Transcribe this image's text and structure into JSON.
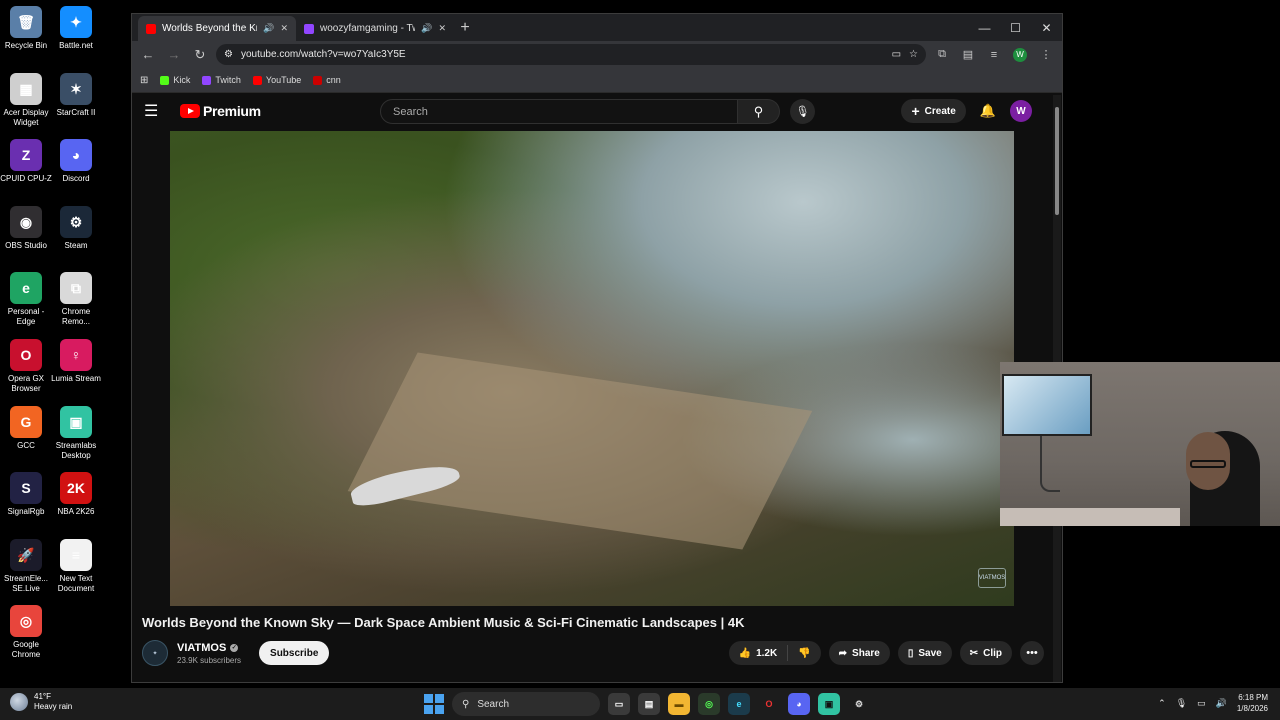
{
  "desktop": {
    "icons": [
      {
        "label": "Recycle Bin",
        "glyph": "🗑",
        "color": "#5a7fa8"
      },
      {
        "label": "Battle.net",
        "glyph": "✦",
        "color": "#148eff"
      },
      {
        "label": "Acer Display Widget",
        "glyph": "▦",
        "color": "#cfcfcf"
      },
      {
        "label": "StarCraft II",
        "glyph": "✶",
        "color": "#3a4e66"
      },
      {
        "label": "CPUID CPU-Z",
        "glyph": "Z",
        "color": "#6a2fb0"
      },
      {
        "label": "Discord",
        "glyph": "◕",
        "color": "#5865f2"
      },
      {
        "label": "OBS Studio",
        "glyph": "◉",
        "color": "#302e31"
      },
      {
        "label": "Steam",
        "glyph": "⚙",
        "color": "#1b2838"
      },
      {
        "label": "Personal - Edge",
        "glyph": "e",
        "color": "#1fa463"
      },
      {
        "label": "Chrome Remo...",
        "glyph": "⧉",
        "color": "#d9d9d9"
      },
      {
        "label": "Opera GX Browser",
        "glyph": "O",
        "color": "#c8102e"
      },
      {
        "label": "Lumia Stream",
        "glyph": "♀",
        "color": "#d81b60"
      },
      {
        "label": "GCC",
        "glyph": "G",
        "color": "#f26522"
      },
      {
        "label": "Streamlabs Desktop",
        "glyph": "▣",
        "color": "#31c3a2"
      },
      {
        "label": "SignalRgb",
        "glyph": "S",
        "color": "#222244"
      },
      {
        "label": "NBA 2K26",
        "glyph": "2K",
        "color": "#d11111"
      },
      {
        "label": "StreamEle... SE.Live",
        "glyph": "🚀",
        "color": "#1b1b2a"
      },
      {
        "label": "New Text Document",
        "glyph": "≡",
        "color": "#f2f2f2"
      },
      {
        "label": "Google Chrome",
        "glyph": "◎",
        "color": "#e8453c"
      }
    ]
  },
  "browser": {
    "tabs": [
      {
        "title": "Worlds Beyond the Known",
        "favicon_color": "#ff0000",
        "active": true
      },
      {
        "title": "woozyfamgaming - Twitch",
        "favicon_color": "#9146ff",
        "active": false
      }
    ],
    "url": "youtube.com/watch?v=wo7YaIc3Y5E",
    "profile_initial": "W",
    "bookmarks": [
      {
        "label": "Kick",
        "color": "#53fc18"
      },
      {
        "label": "Twitch",
        "color": "#9146ff"
      },
      {
        "label": "YouTube",
        "color": "#ff0000"
      },
      {
        "label": "cnn",
        "color": "#cc0000"
      }
    ]
  },
  "youtube": {
    "logo_text": "Premium",
    "search_placeholder": "Search",
    "create_label": "Create",
    "avatar_initial": "W",
    "video_title": "Worlds Beyond the Known Sky — Dark Space Ambient Music & Sci-Fi Cinematic Landscapes | 4K",
    "watermark": "VIATMOS",
    "channel": {
      "name": "VIATMOS",
      "subscribers": "23.9K subscribers",
      "subscribe_label": "Subscribe"
    },
    "actions": {
      "likes": "1.2K",
      "share": "Share",
      "save": "Save",
      "clip": "Clip"
    }
  },
  "taskbar": {
    "weather_temp": "41°F",
    "weather_desc": "Heavy rain",
    "search_label": "Search",
    "time": "6:18 PM",
    "date": "1/8/2026"
  }
}
